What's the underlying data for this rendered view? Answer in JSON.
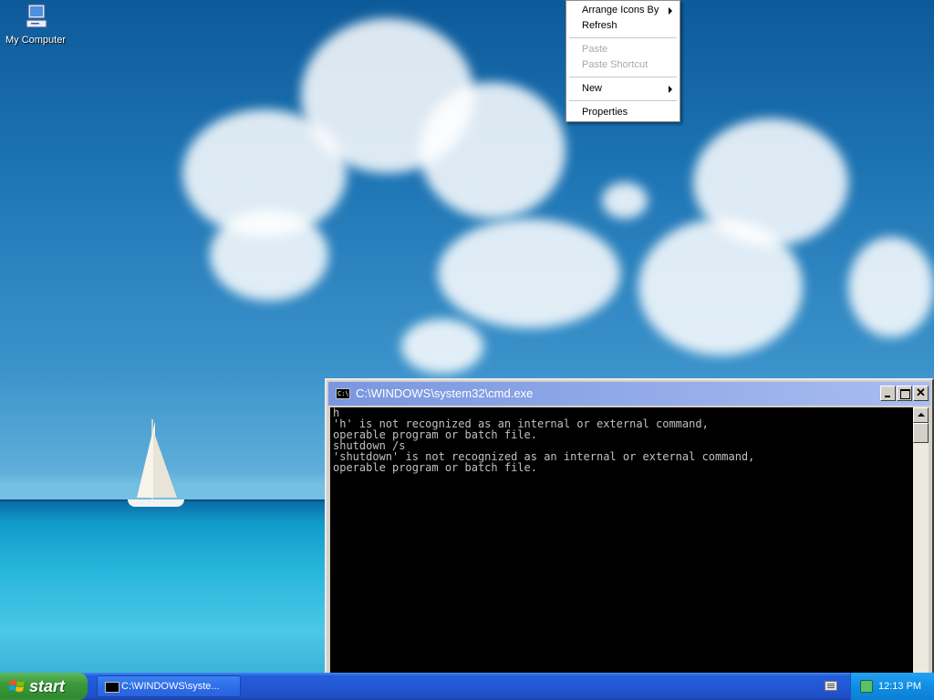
{
  "desktop": {
    "icons": [
      {
        "label": "My Computer",
        "icon": "my-computer-icon"
      }
    ]
  },
  "context_menu": {
    "items": [
      {
        "label": "Arrange Icons By",
        "submenu": true,
        "enabled": true
      },
      {
        "label": "Refresh",
        "submenu": false,
        "enabled": true
      },
      {
        "label": "Paste",
        "submenu": false,
        "enabled": false
      },
      {
        "label": "Paste Shortcut",
        "submenu": false,
        "enabled": false
      },
      {
        "label": "New",
        "submenu": true,
        "enabled": true
      },
      {
        "label": "Properties",
        "submenu": false,
        "enabled": true
      }
    ]
  },
  "cmd_window": {
    "title": "C:\\WINDOWS\\system32\\cmd.exe",
    "console_lines": [
      "h",
      "'h' is not recognized as an internal or external command,",
      "operable program or batch file.",
      "shutdown /s",
      "'shutdown' is not recognized as an internal or external command,",
      "operable program or batch file."
    ]
  },
  "taskbar": {
    "start_label": "start",
    "task_buttons": [
      {
        "label": "C:\\WINDOWS\\syste...",
        "icon": "cmd-icon"
      }
    ],
    "clock": "12:13 PM"
  }
}
